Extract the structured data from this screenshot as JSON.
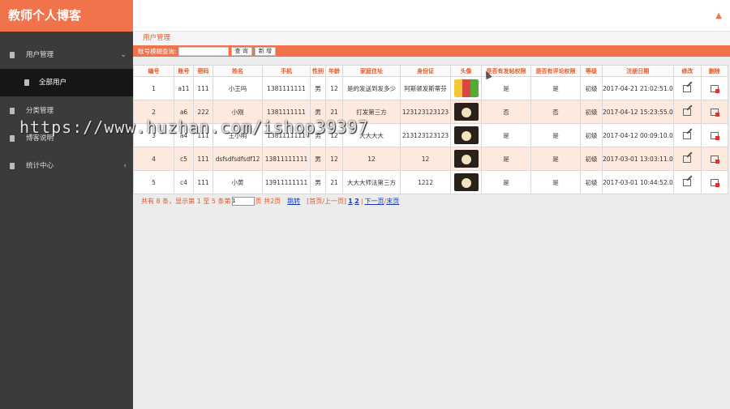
{
  "app": {
    "title": "教师个人博客"
  },
  "sidebar": {
    "items": [
      {
        "label": "用户管理",
        "chevron": "⌄",
        "expanded": true
      },
      {
        "label": "全部用户",
        "active": true
      },
      {
        "label": "分类管理"
      },
      {
        "label": "博客说明"
      },
      {
        "label": "统计中心",
        "chevron": "‹"
      }
    ]
  },
  "header": {
    "user_icon": "▲"
  },
  "main": {
    "breadcrumb": "用户管理",
    "search": {
      "label": "账号模糊查询:",
      "value": "",
      "query_button": "查 询",
      "add_button": "新 增"
    },
    "table": {
      "headers": [
        "编号",
        "账号",
        "密码",
        "姓名",
        "手机",
        "性别",
        "年龄",
        "家庭住址",
        "身份证",
        "头像",
        "是否有发帖权限",
        "是否有评论权限",
        "等级",
        "注册日期",
        "修改",
        "删除"
      ],
      "rows": [
        {
          "id": "1",
          "account": "a11",
          "password": "111",
          "name": "小王吗",
          "phone": "1381111111",
          "gender": "男",
          "age": "12",
          "address": "是的发送到发多少",
          "idcard": "阿斯顿发斯蒂芬",
          "avatar": "cartoon-avatar",
          "post_perm": "是",
          "comment_perm": "是",
          "level": "初级",
          "reg_date": "2017-04-21 21:02:51.0"
        },
        {
          "id": "2",
          "account": "a6",
          "password": "222",
          "name": "小刚",
          "phone": "1381111111",
          "gender": "男",
          "age": "21",
          "address": "打发第三方",
          "idcard": "123123123123",
          "avatar": "photo-avatar",
          "post_perm": "否",
          "comment_perm": "否",
          "level": "初级",
          "reg_date": "2017-04-12 15:23:55.0"
        },
        {
          "id": "3",
          "account": "a4",
          "password": "111",
          "name": "王小明",
          "phone": "1381111111",
          "gender": "男",
          "age": "12",
          "address": "大大大大",
          "idcard": "213123123123",
          "avatar": "photo-avatar",
          "post_perm": "是",
          "comment_perm": "是",
          "level": "初级",
          "reg_date": "2017-04-12 00:09:10.0"
        },
        {
          "id": "4",
          "account": "c5",
          "password": "111",
          "name": "dsfsdfsdfsdf12",
          "phone": "13811111111",
          "gender": "男",
          "age": "12",
          "address": "12",
          "idcard": "12",
          "avatar": "photo-avatar",
          "post_perm": "是",
          "comment_perm": "是",
          "level": "初级",
          "reg_date": "2017-03-01 13:03:11.0"
        },
        {
          "id": "5",
          "account": "c4",
          "password": "111",
          "name": "小黄",
          "phone": "13911111111",
          "gender": "男",
          "age": "21",
          "address": "大大大师法第三方",
          "idcard": "1212",
          "avatar": "photo-avatar",
          "post_perm": "是",
          "comment_perm": "是",
          "level": "初级",
          "reg_date": "2017-03-01 10:44:52.0"
        }
      ]
    },
    "pager": {
      "summary_a": "共有 8 条，显示第 1 至 5 条第",
      "page_value": "1",
      "summary_b": "页 共2页",
      "jump": "跳转",
      "first_prev": "[首页/上一页]",
      "page1": "1",
      "sep": ",",
      "page2": "2",
      "bar": "|",
      "next": "下一页",
      "slash": "/",
      "last": "末页"
    }
  },
  "watermark": "https://www.huzhan.com/ishop39397"
}
